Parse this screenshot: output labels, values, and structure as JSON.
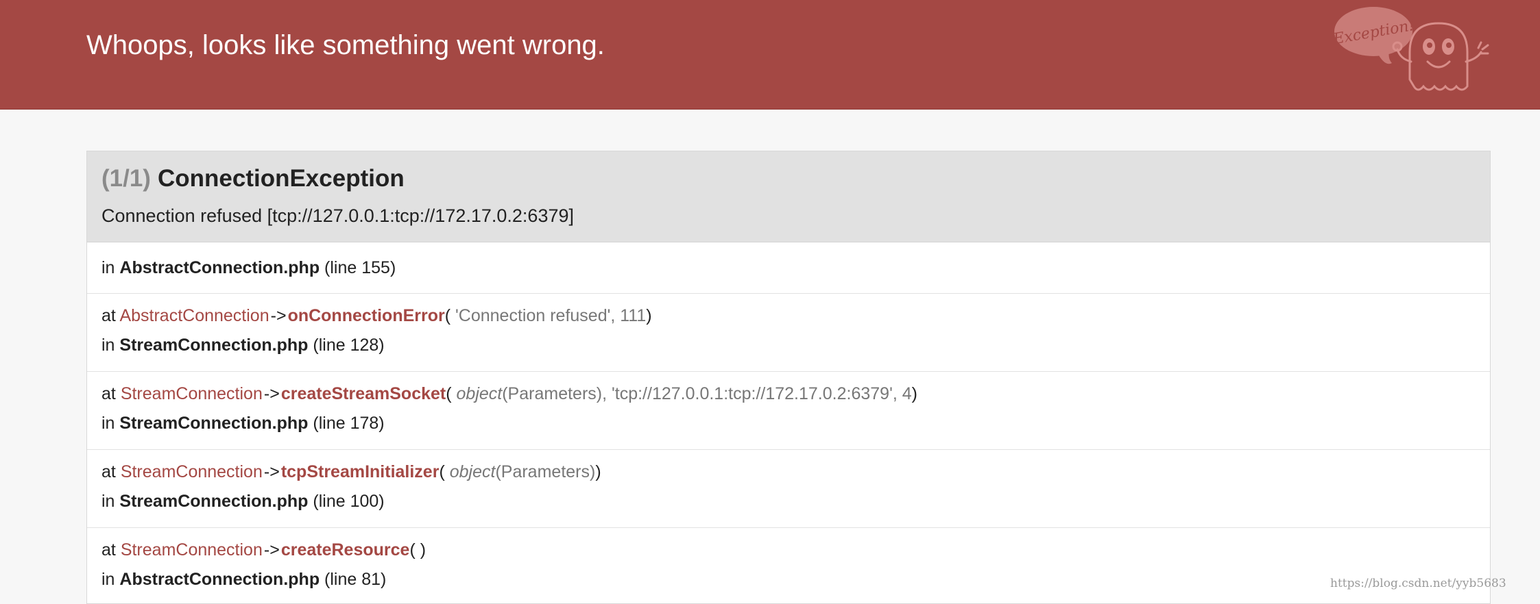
{
  "header": {
    "title": "Whoops, looks like something went wrong.",
    "mascot_bubble_text": "Exception!"
  },
  "exception": {
    "count": "(1/1)",
    "name": "ConnectionException",
    "message": "Connection refused [tcp://127.0.0.1:tcp://172.17.0.2:6379]"
  },
  "origin": {
    "in_label": "in",
    "file": "AbstractConnection.php",
    "line": "(line 155)"
  },
  "trace": [
    {
      "at_label": "at",
      "class": "AbstractConnection",
      "arrow": "->",
      "method": "onConnectionError",
      "open": "(",
      "args": [
        {
          "text": "'Connection refused', 111",
          "italic": false
        }
      ],
      "close": ")",
      "in_label": "in",
      "file": "StreamConnection.php",
      "line": "(line 128)"
    },
    {
      "at_label": "at",
      "class": "StreamConnection",
      "arrow": "->",
      "method": "createStreamSocket",
      "open": "(",
      "args": [
        {
          "text": "object",
          "italic": true
        },
        {
          "text": "(Parameters), 'tcp://127.0.0.1:tcp://172.17.0.2:6379', 4",
          "italic": false
        }
      ],
      "close": ")",
      "in_label": "in",
      "file": "StreamConnection.php",
      "line": "(line 178)"
    },
    {
      "at_label": "at",
      "class": "StreamConnection",
      "arrow": "->",
      "method": "tcpStreamInitializer",
      "open": "(",
      "args": [
        {
          "text": "object",
          "italic": true
        },
        {
          "text": "(Parameters)",
          "italic": false
        }
      ],
      "close": ")",
      "in_label": "in",
      "file": "StreamConnection.php",
      "line": "(line 100)"
    },
    {
      "at_label": "at",
      "class": "StreamConnection",
      "arrow": "->",
      "method": "createResource",
      "open": "(",
      "args": [],
      "close": ")",
      "in_label": "in",
      "file": "AbstractConnection.php",
      "line": "(line 81)"
    }
  ],
  "watermark": "https://blog.csdn.net/yyb5683",
  "colors": {
    "header_bg": "#a44844",
    "accent": "#a44844",
    "exception_head_bg": "#e1e1e1",
    "page_bg": "#f7f7f7"
  }
}
